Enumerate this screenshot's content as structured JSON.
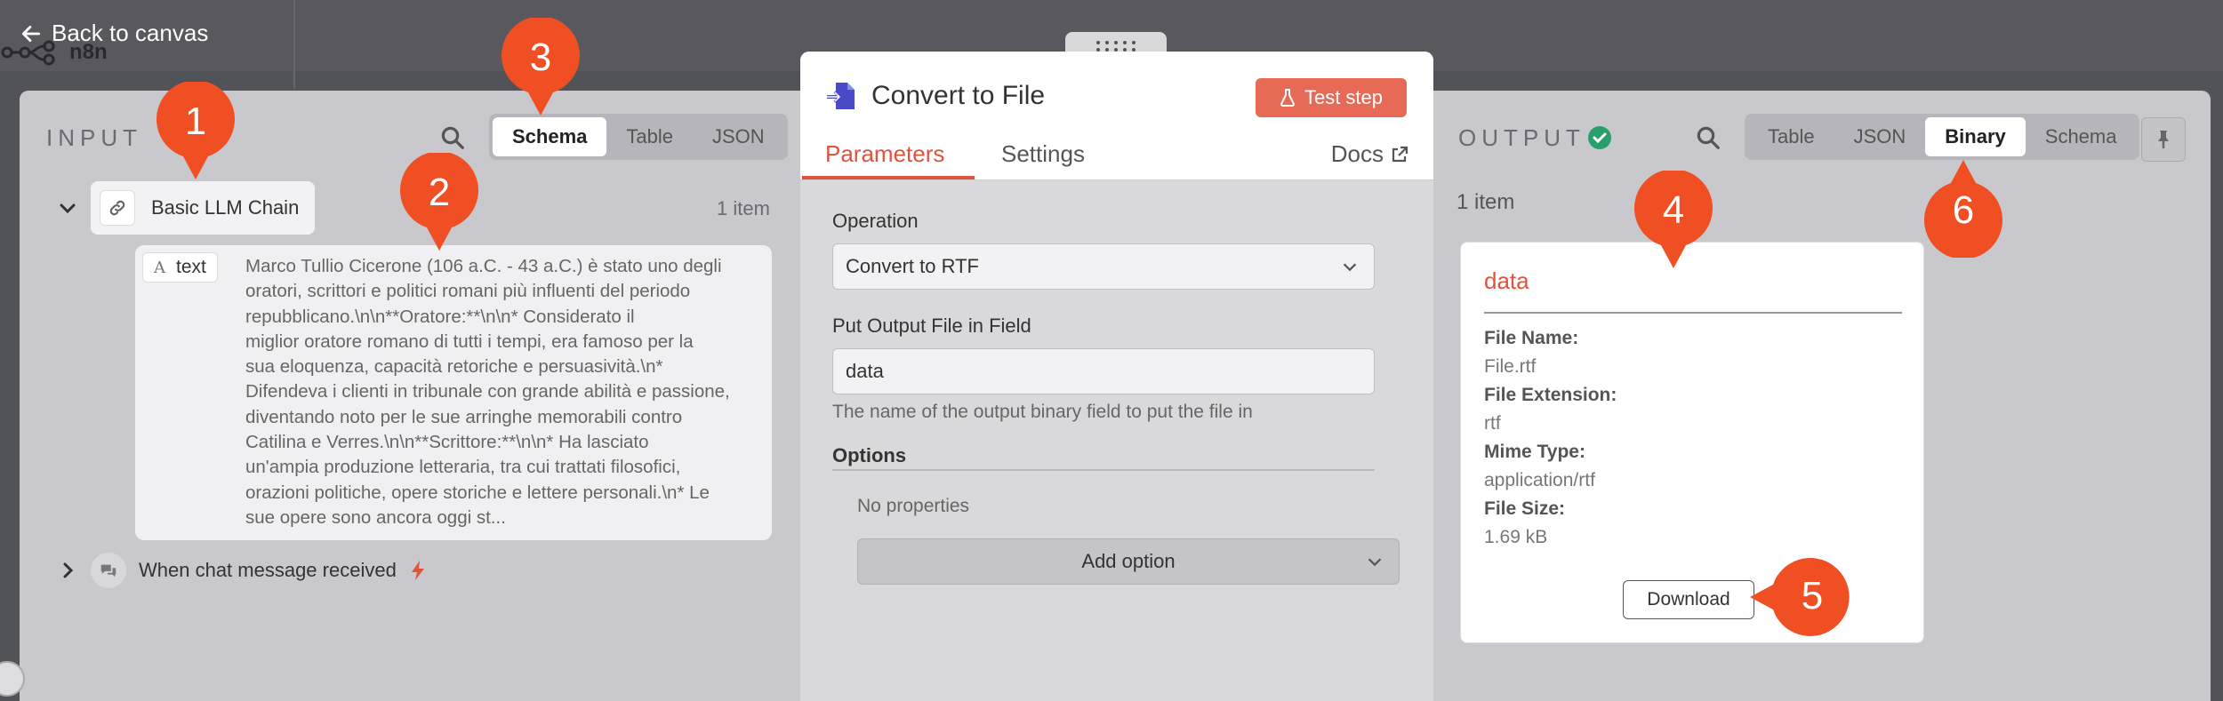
{
  "topbar": {
    "back_label": "Back to canvas",
    "logo_text": "n8n"
  },
  "input": {
    "title": "INPUT",
    "views": [
      "Schema",
      "Table",
      "JSON"
    ],
    "active_view": "Schema",
    "node_name": "Basic LLM Chain",
    "item_count": "1 item",
    "field_name": "text",
    "text_lines": [
      "Marco Tullio Cicerone (106 a.C. - 43 a.C.) è stato uno degli",
      "oratori, scrittori e politici romani più influenti del periodo",
      "repubblicano.\\n\\n**Oratore:**\\n\\n* Considerato il",
      "miglior oratore romano di tutti i tempi, era famoso per la",
      "sua eloquenza, capacità retoriche e persuasività.\\n*",
      "Difendeva i clienti in tribunale con grande abilità e passione,",
      "diventando noto per le sue arringhe memorabili contro",
      "Catilina e Verres.\\n\\n**Scrittore:**\\n\\n* Ha lasciato",
      "un'ampia produzione letteraria, tra cui trattati filosofici,",
      "orazioni politiche, opere storiche e lettere personali.\\n* Le",
      "sue opere sono ancora oggi st..."
    ],
    "trigger_name": "When chat message received"
  },
  "node": {
    "title": "Convert to File",
    "test_button": "Test step",
    "tabs": [
      "Parameters",
      "Settings"
    ],
    "docs_label": "Docs",
    "operation_label": "Operation",
    "operation_value": "Convert to RTF",
    "output_field_label": "Put Output File in Field",
    "output_field_value": "data",
    "output_field_hint": "The name of the output binary field to put the file in",
    "options_label": "Options",
    "no_properties": "No properties",
    "add_option": "Add option"
  },
  "output": {
    "title": "OUTPUT",
    "views": [
      "Table",
      "JSON",
      "Binary",
      "Schema"
    ],
    "active_view": "Binary",
    "item_count": "1 item",
    "binary": {
      "name": "data",
      "file_name_label": "File Name:",
      "file_name": "File.rtf",
      "extension_label": "File Extension:",
      "extension": "rtf",
      "mime_label": "Mime Type:",
      "mime": "application/rtf",
      "size_label": "File Size:",
      "size": "1.69 kB",
      "download": "Download"
    }
  },
  "markers": [
    "1",
    "2",
    "3",
    "4",
    "5",
    "6"
  ],
  "colors": {
    "accent": "#e0533c",
    "marker": "#f04e23",
    "success": "#29a06b"
  }
}
